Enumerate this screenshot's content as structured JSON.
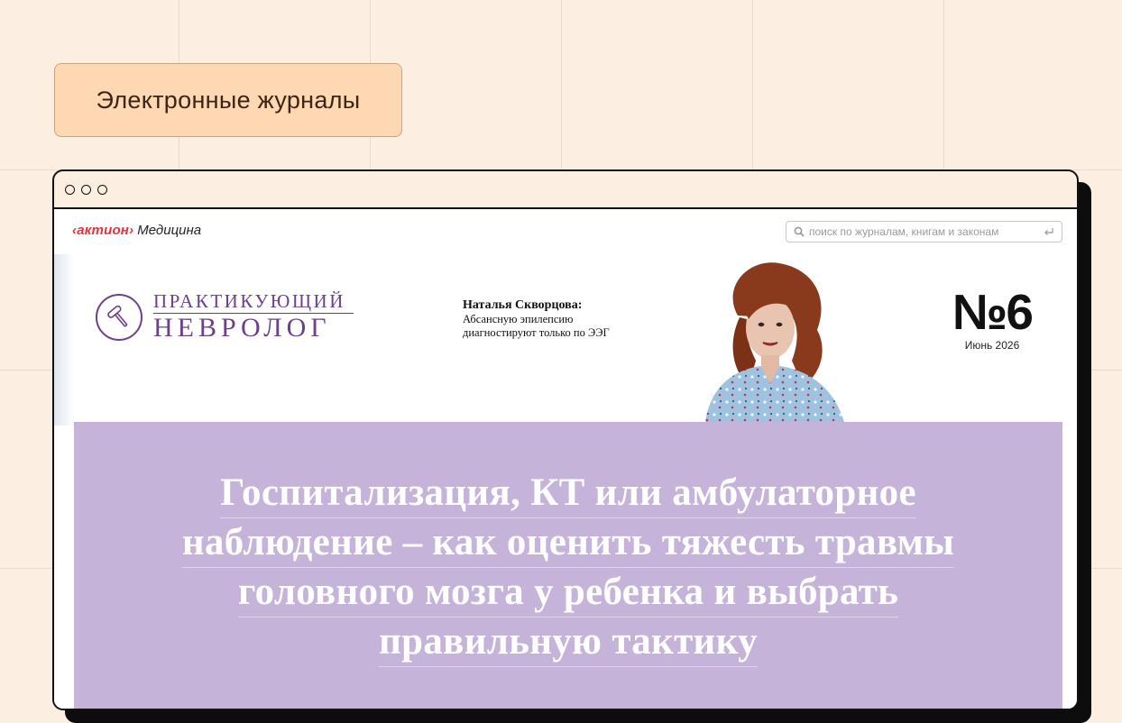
{
  "colors": {
    "background": "#fdeee2",
    "pill_bg": "#fdd8b3",
    "brand_red": "#e8313a",
    "logo_purple": "#6d3f8c",
    "banner": "#c5b3d9"
  },
  "category_button": {
    "label": "Электронные журналы"
  },
  "browser": {
    "site": {
      "brand_name": "‹актион›",
      "brand_suffix": "Медицина"
    },
    "search": {
      "placeholder": "поиск по журналам, книгам и законам",
      "icon": "search-icon",
      "submit_icon": "enter-icon"
    },
    "journal": {
      "logo_line1": "ПРАКТИКУЮЩИЙ",
      "logo_line2": "НЕВРОЛОГ",
      "logo_icon": "reflex-hammer-icon"
    },
    "teaser": {
      "name": "Наталья Скворцова:",
      "line1": "Абсансную эпилепсию",
      "line2": "диагностируют только по ЭЭГ"
    },
    "issue": {
      "number": "№6",
      "date": "Июнь 2026"
    },
    "headline": {
      "lines": [
        "Госпитализация, КТ или амбулаторное",
        "наблюдение – как оценить тяжесть травмы",
        "головного мозга у ребенка и выбрать",
        "правильную тактику"
      ]
    }
  }
}
